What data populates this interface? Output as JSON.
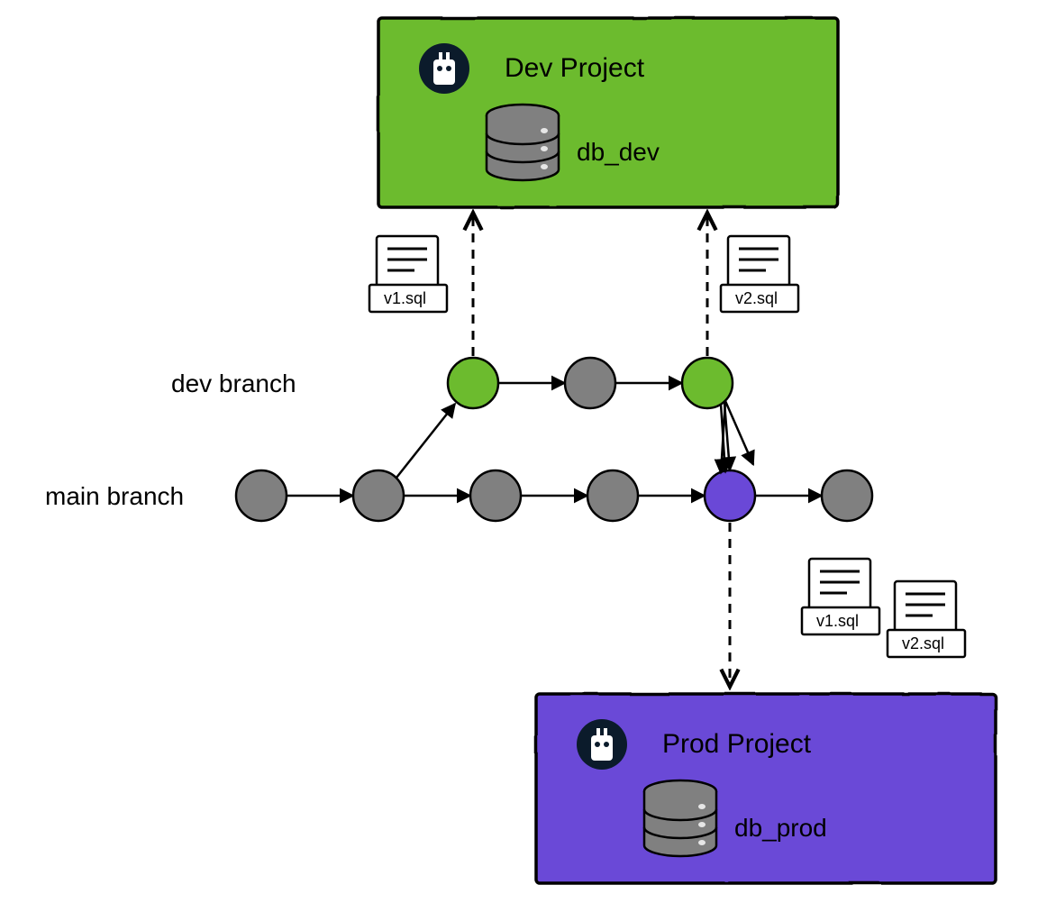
{
  "colors": {
    "green": "#6cbb2e",
    "purple": "#6a48d7",
    "gray": "#808080",
    "darkNavy": "#0b1b2b",
    "black": "#000000",
    "white": "#ffffff"
  },
  "projects": {
    "dev": {
      "title": "Dev Project",
      "db": "db_dev"
    },
    "prod": {
      "title": "Prod Project",
      "db": "db_prod"
    }
  },
  "branches": {
    "dev": {
      "label": "dev branch"
    },
    "main": {
      "label": "main branch"
    }
  },
  "files": {
    "v1": "v1.sql",
    "v2": "v2.sql"
  }
}
